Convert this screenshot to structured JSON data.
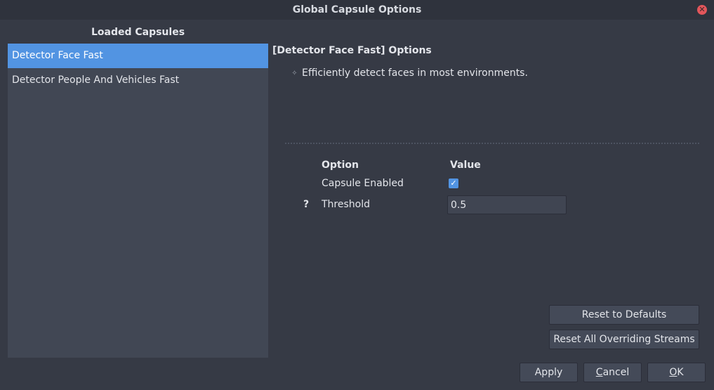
{
  "window": {
    "title": "Global Capsule Options",
    "close_icon": "close-icon"
  },
  "sidebar": {
    "heading": "Loaded Capsules",
    "items": [
      {
        "label": "Detector Face Fast",
        "selected": true
      },
      {
        "label": "Detector People And Vehicles Fast",
        "selected": false
      }
    ]
  },
  "options": {
    "heading": "[Detector Face Fast] Options",
    "description_icon": "sparkle-icon",
    "description": "Efficiently detect faces in most environments.",
    "columns": {
      "option": "Option",
      "value": "Value"
    },
    "rows": [
      {
        "label": "Capsule Enabled",
        "type": "checkbox",
        "checked": true
      },
      {
        "label": "Threshold",
        "type": "text",
        "value": "0.5",
        "help": "?"
      }
    ]
  },
  "buttons": {
    "reset_defaults": "Reset to Defaults",
    "reset_streams": "Reset All Overriding Streams",
    "apply": "Apply",
    "cancel_first": "C",
    "cancel_rest": "ancel",
    "ok_first": "O",
    "ok_rest": "K"
  },
  "colors": {
    "accent": "#5294e2",
    "background": "#363a45",
    "panel": "#414754",
    "close": "#e3565b"
  }
}
